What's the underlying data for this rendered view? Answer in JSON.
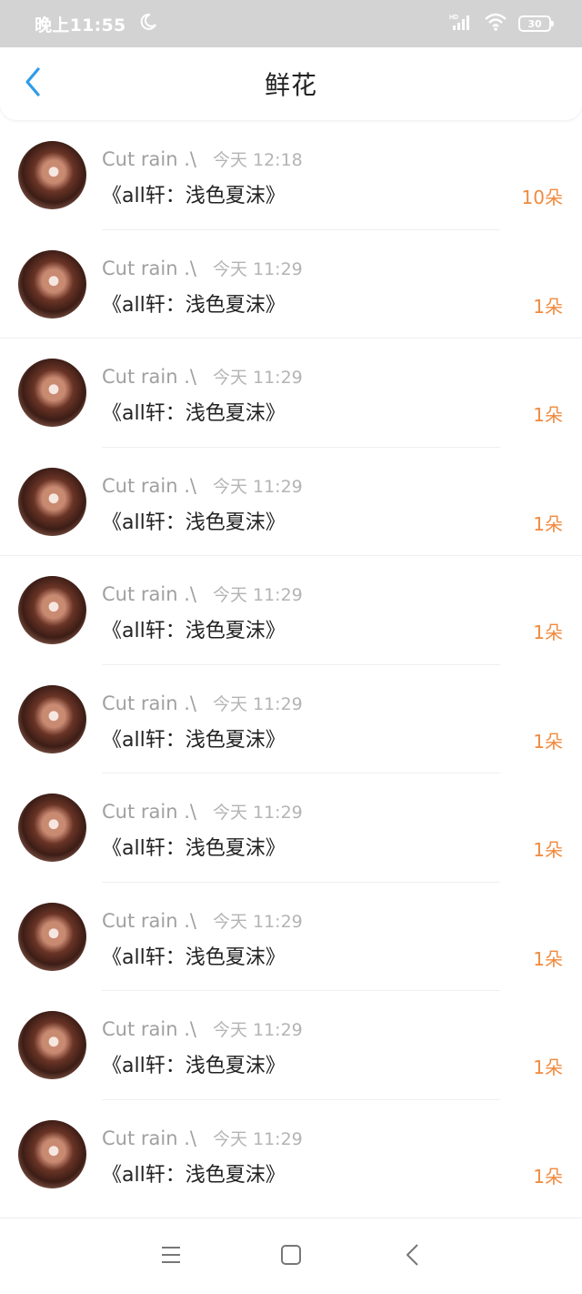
{
  "status_bar": {
    "time": "晚上11:55",
    "battery": "30",
    "icons": [
      "moon-icon",
      "hd-signal-icon",
      "wifi-icon",
      "battery-icon"
    ]
  },
  "header": {
    "title": "鲜花",
    "back_icon": "chevron-left-icon"
  },
  "items": [
    {
      "name": "Cut rain .\\",
      "time": "今天 12:18",
      "book": "《all轩：浅色夏沫》",
      "flowers": "10朵"
    },
    {
      "name": "Cut rain .\\",
      "time": "今天 11:29",
      "book": "《all轩：浅色夏沫》",
      "flowers": "1朵"
    },
    {
      "name": "Cut rain .\\",
      "time": "今天 11:29",
      "book": "《all轩：浅色夏沫》",
      "flowers": "1朵"
    },
    {
      "name": "Cut rain .\\",
      "time": "今天 11:29",
      "book": "《all轩：浅色夏沫》",
      "flowers": "1朵"
    },
    {
      "name": "Cut rain .\\",
      "time": "今天 11:29",
      "book": "《all轩：浅色夏沫》",
      "flowers": "1朵"
    },
    {
      "name": "Cut rain .\\",
      "time": "今天 11:29",
      "book": "《all轩：浅色夏沫》",
      "flowers": "1朵"
    },
    {
      "name": "Cut rain .\\",
      "time": "今天 11:29",
      "book": "《all轩：浅色夏沫》",
      "flowers": "1朵"
    },
    {
      "name": "Cut rain .\\",
      "time": "今天 11:29",
      "book": "《all轩：浅色夏沫》",
      "flowers": "1朵"
    },
    {
      "name": "Cut rain .\\",
      "time": "今天 11:29",
      "book": "《all轩：浅色夏沫》",
      "flowers": "1朵"
    },
    {
      "name": "Cut rain .\\",
      "time": "今天 11:29",
      "book": "《all轩：浅色夏沫》",
      "flowers": "1朵"
    }
  ],
  "nav_bar": {
    "icons": [
      "menu-icon",
      "home-square-icon",
      "back-triangle-icon"
    ]
  },
  "colors": {
    "accent": "#2f9be8",
    "flowers": "#f08a3e",
    "status_bar_bg": "#d3d3d3"
  }
}
